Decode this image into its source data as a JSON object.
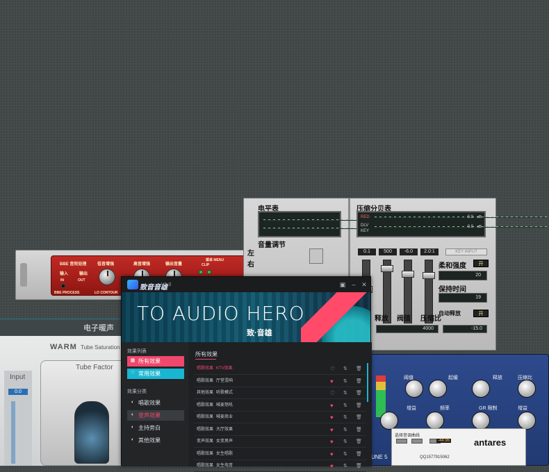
{
  "colors": {
    "accent_pink": "#f0476d",
    "accent_cyan": "#19b6d2",
    "background": "#454b4b"
  },
  "rack": {
    "brand": "BBE 音效处理",
    "header_right": "菜单 MENU",
    "knobs": [
      "低音增强",
      "高音增强",
      "输出音量"
    ],
    "labels": {
      "input": "输入",
      "output": "输出",
      "in": "IN",
      "out": "OUT",
      "process": "BBE PROCESS",
      "contour": "LO CONTOUR",
      "clip": "CLIP"
    }
  },
  "meters": {
    "level_title": "电平表",
    "volume_title": "音量调节",
    "left_label": "左",
    "right_label": "右",
    "comp_title": "压缩分贝表",
    "red_label": "RED",
    "dlv_label": "DLV",
    "key_label": "KEY",
    "db_label": "dB",
    "zero1": "0.0",
    "zero2": "0.0",
    "displays": [
      "0.1",
      "500",
      "-6.0",
      "2.0:1"
    ],
    "key_input": "KEY INPUT",
    "soft_label": "柔和强度",
    "soft_btn": "开",
    "hold_label": "保持时间",
    "hold_value": "20",
    "auto_release_label": "自动释放",
    "auto_btn": "开",
    "release_value": "19",
    "bottom_labels": [
      "释放",
      "阀值",
      "压缩比"
    ],
    "bottom_value1": "4000",
    "bottom_value2": "-15.0"
  },
  "effect_strip": {
    "label": "电子暖声"
  },
  "warm": {
    "title": "WARM",
    "subtitle": "Tube Saturation",
    "tube_label": "Tube Factor",
    "input_label": "Input",
    "input_value": "0.0"
  },
  "blue": {
    "labels": [
      "阈值",
      "起缓",
      "释放",
      "压缩比",
      "增益",
      "频率",
      "GR 限制",
      "增益"
    ]
  },
  "antares": {
    "brand": "antares",
    "line1": "选择音调曲线",
    "value": "-44.96",
    "qq": "QQ1577915062",
    "sub": "UNE 5"
  },
  "app": {
    "name": "致音音雄",
    "version": "V1.0",
    "banner_title": "TO AUDIO HERO",
    "banner_sub": "致·音雄",
    "nav": {
      "list_header": "效果列表",
      "list_items": [
        {
          "icon": "grid-icon",
          "label": "所有效果",
          "state": "pink"
        },
        {
          "icon": "heart-icon",
          "label": "常用效果",
          "state": "cyan"
        }
      ],
      "cat_header": "效果分类",
      "cat_items": [
        {
          "label": "唱歌效果",
          "state": ""
        },
        {
          "label": "变声效果",
          "state": "dark"
        },
        {
          "label": "主持旁白",
          "state": ""
        },
        {
          "label": "其他效果",
          "state": ""
        }
      ]
    },
    "content_title": "所有效果",
    "rows": [
      {
        "cat": "唱歌效果",
        "name": "KTV效果",
        "fav": false,
        "active": true
      },
      {
        "cat": "唱歌效果",
        "name": "厅堂混响",
        "fav": true,
        "active": false
      },
      {
        "cat": "其他效果",
        "name": "听歌模式",
        "fav": false,
        "active": false
      },
      {
        "cat": "唱歌效果",
        "name": "喊麦怒吼",
        "fav": true,
        "active": false
      },
      {
        "cat": "唱歌效果",
        "name": "喊麦商业",
        "fav": true,
        "active": false
      },
      {
        "cat": "唱歌效果",
        "name": "大厅效果",
        "fav": true,
        "active": false
      },
      {
        "cat": "变声效果",
        "name": "女变男声",
        "fav": true,
        "active": false
      },
      {
        "cat": "唱歌效果",
        "name": "女生唱歌",
        "fav": true,
        "active": false
      },
      {
        "cat": "唱歌效果",
        "name": "女生电音",
        "fav": true,
        "active": false
      }
    ]
  }
}
